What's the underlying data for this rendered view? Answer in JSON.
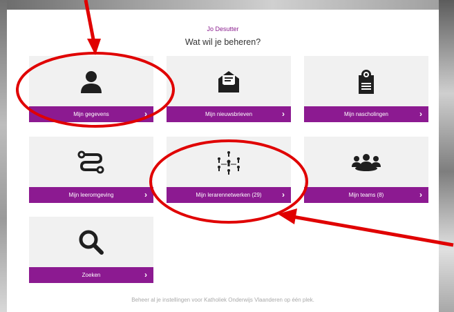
{
  "header": {
    "user_name": "Jo Desutter",
    "question": "Wat wil je beheren?"
  },
  "tiles": [
    {
      "label": "Mijn gegevens",
      "icon": "user-icon"
    },
    {
      "label": "Mijn nieuwsbrieven",
      "icon": "newsletter-envelope-icon"
    },
    {
      "label": "Mijn nascholingen",
      "icon": "certificate-icon"
    },
    {
      "label": "Mijn leeromgeving",
      "icon": "route-icon"
    },
    {
      "label": "Mijn lerarennetwerken (29)",
      "icon": "network-icon"
    },
    {
      "label": "Mijn teams (8)",
      "icon": "team-icon"
    },
    {
      "label": "Zoeken",
      "icon": "search-icon"
    }
  ],
  "chevron": "›",
  "footer": "Beheer al je instellingen voor Katholiek Onderwijs Vlaanderen op één plek.",
  "colors": {
    "accent": "#8c1a91",
    "tile_bg": "#f1f1f1",
    "annotation": "#e00000"
  }
}
